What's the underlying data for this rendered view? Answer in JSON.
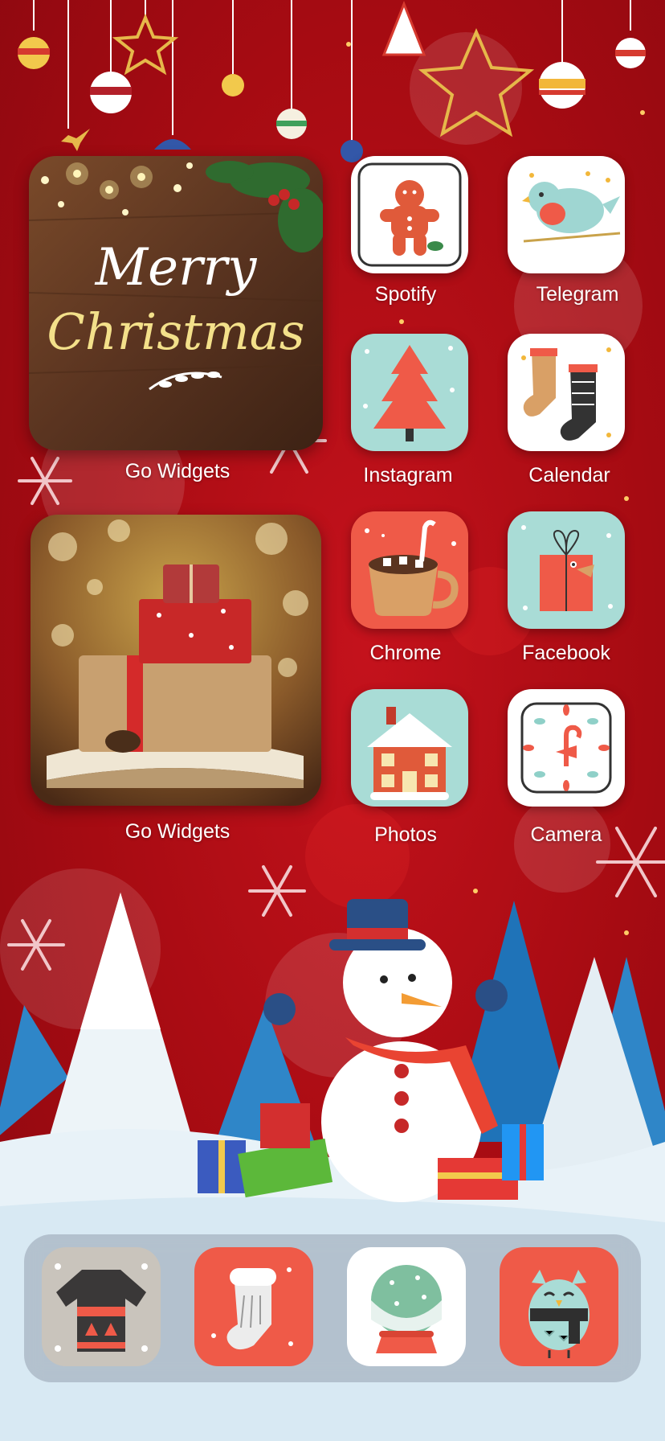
{
  "colors": {
    "background": "#a60b12",
    "snow": "#e8f2f8",
    "icon_red": "#ef5a48",
    "icon_mint": "#a9dcd6",
    "icon_white": "#ffffff"
  },
  "widgets": [
    {
      "label": "Go Widgets",
      "image_text": "Merry Christmas",
      "image": "merry-christmas-wood-photo"
    },
    {
      "label": "Go Widgets",
      "image": "gift-boxes-on-book-photo"
    }
  ],
  "apps": [
    {
      "label": "Spotify",
      "icon": "gingerbread-man-icon"
    },
    {
      "label": "Telegram",
      "icon": "bird-icon"
    },
    {
      "label": "Instagram",
      "icon": "christmas-tree-icon"
    },
    {
      "label": "Calendar",
      "icon": "stockings-icon"
    },
    {
      "label": "Chrome",
      "icon": "hot-cocoa-icon"
    },
    {
      "label": "Facebook",
      "icon": "gift-box-icon"
    },
    {
      "label": "Photos",
      "icon": "snowy-house-icon"
    },
    {
      "label": "Camera",
      "icon": "candy-cane-clock-icon"
    }
  ],
  "dock": [
    {
      "icon": "ugly-sweater-icon"
    },
    {
      "icon": "christmas-stocking-icon"
    },
    {
      "icon": "snow-globe-icon"
    },
    {
      "icon": "owl-icon"
    }
  ]
}
